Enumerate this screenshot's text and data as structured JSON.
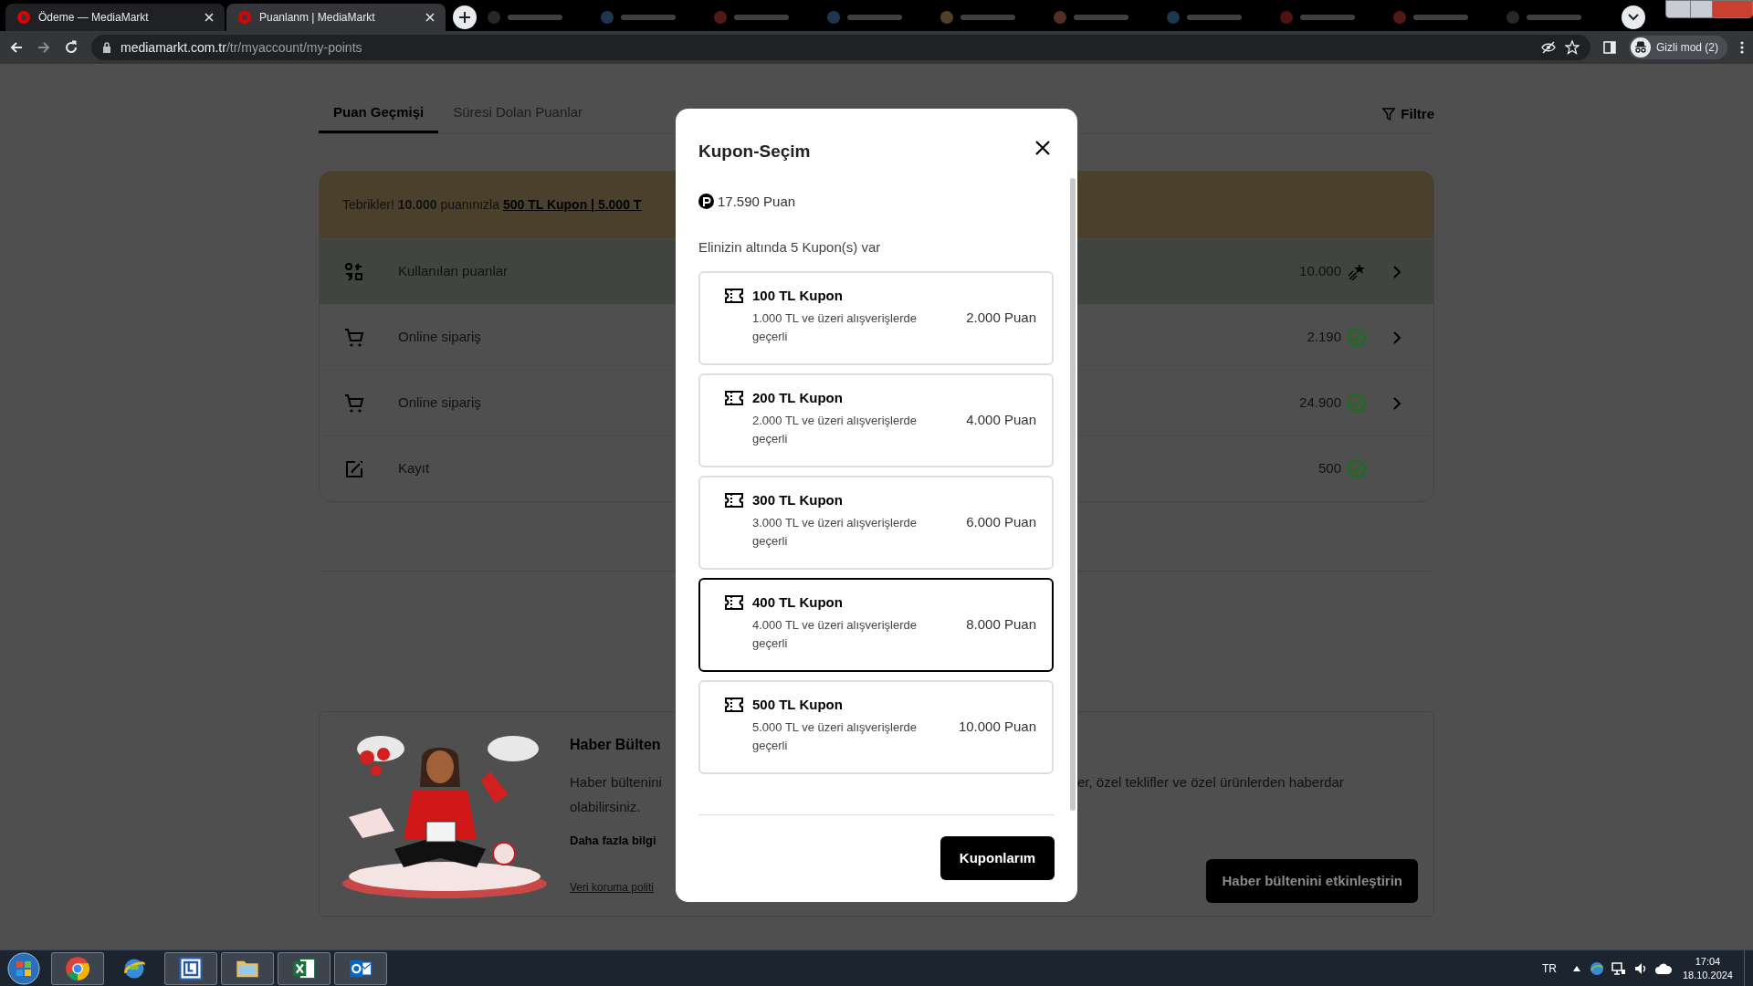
{
  "browser": {
    "tabs": [
      {
        "title": "Ödeme — MediaMarkt",
        "selected": false
      },
      {
        "title": "Puanlanm | MediaMarkt",
        "selected": true
      }
    ],
    "url_host": "mediamarkt.com.tr",
    "url_path": "/tr/myaccount/my-points",
    "profile": "Gizli mod (2)"
  },
  "page": {
    "tabs": [
      {
        "label": "Puan Geçmişi",
        "selected": true
      },
      {
        "label": "Süresi Dolan Puanlar",
        "selected": false
      }
    ],
    "filter": "Filtre",
    "banner": {
      "text": "Tebrikler! **10.000** puanınızla",
      "link": "500 TL Kupon | 5.000 T"
    },
    "history": [
      {
        "kind": "redeemed",
        "label": "Kullanılan puanlar",
        "value": "10.000",
        "chevron": true,
        "highlighted": true
      },
      {
        "kind": "order",
        "label": "Online sipariş",
        "value": "2.190",
        "chevron": true,
        "highlighted": false
      },
      {
        "kind": "order",
        "label": "Online sipariş",
        "value": "24.900",
        "chevron": true,
        "highlighted": false
      },
      {
        "kind": "signup",
        "label": "Kayıt",
        "value": "500",
        "chevron": false,
        "highlighted": false
      }
    ],
    "newsletter": {
      "title": "Haber Bülten",
      "text_left": "Haber bültenini",
      "text_right": "er, özel teklifler ve özel ürünlerden haberdar",
      "text_continued": "olabilirsiniz.",
      "more": "Daha fazla bilgi",
      "privacy_link": "Veri koruma politi",
      "button": "Haber bültenini etkinleştirin"
    }
  },
  "modal": {
    "title": "Kupon-Seçim",
    "points": "17.590 Puan",
    "count_text": "Elinizin altında 5 Kupon(s) var",
    "coupons": [
      {
        "title": "100 TL Kupon",
        "condition": "1.000 TL ve üzeri alışverişlerde geçerli",
        "price": "2.000 Puan",
        "selected": false
      },
      {
        "title": "200 TL Kupon",
        "condition": "2.000 TL ve üzeri alışverişlerde geçerli",
        "price": "4.000 Puan",
        "selected": false
      },
      {
        "title": "300 TL Kupon",
        "condition": "3.000 TL ve üzeri alışverişlerde geçerli",
        "price": "6.000 Puan",
        "selected": false
      },
      {
        "title": "400 TL Kupon",
        "condition": "4.000 TL ve üzeri alışverişlerde geçerli",
        "price": "8.000 Puan",
        "selected": true
      },
      {
        "title": "500 TL Kupon",
        "condition": "5.000 TL ve üzeri alışverişlerde geçerli",
        "price": "10.000 Puan",
        "selected": false
      }
    ],
    "button": "Kuponlarım"
  },
  "taskbar": {
    "apps": [
      {
        "kind": "chrome",
        "open": true
      },
      {
        "kind": "globe",
        "open": false
      },
      {
        "kind": "window",
        "open": true
      },
      {
        "kind": "folder",
        "open": true
      },
      {
        "kind": "excel",
        "open": true
      },
      {
        "kind": "outlook",
        "open": true
      }
    ],
    "language": "TR",
    "time": "17:04",
    "date": "18.10.2024"
  }
}
